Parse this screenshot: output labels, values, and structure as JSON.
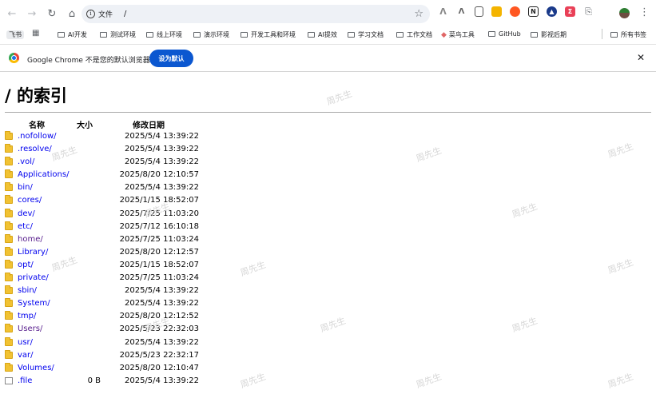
{
  "browser": {
    "site_label": "文件",
    "url": "/",
    "bookmarks": [
      {
        "label": "飞书",
        "type": "chip"
      },
      {
        "label": "AI开发",
        "type": "folder"
      },
      {
        "label": "测试环境",
        "type": "folder"
      },
      {
        "label": "线上环境",
        "type": "folder"
      },
      {
        "label": "演示环境",
        "type": "folder"
      },
      {
        "label": "开发工具和环境",
        "type": "folder"
      },
      {
        "label": "AI提效",
        "type": "folder"
      },
      {
        "label": "学习文档",
        "type": "folder"
      },
      {
        "label": "工作文档",
        "type": "folder"
      },
      {
        "label": "菜鸟工具",
        "type": "site"
      },
      {
        "label": "GitHub",
        "type": "folder"
      },
      {
        "label": "影视后期",
        "type": "folder"
      },
      {
        "label": "所有书签",
        "type": "folder"
      }
    ]
  },
  "infobar": {
    "message": "Google Chrome 不是您的默认浏览器",
    "button_label": "设为默认"
  },
  "page": {
    "title": "/ 的索引",
    "columns": {
      "name": "名称",
      "size": "大小",
      "date": "修改日期"
    },
    "entries": [
      {
        "name": ".nofollow/",
        "size": "",
        "date": "2025/5/4 13:39:22",
        "kind": "folder",
        "visited": false
      },
      {
        "name": ".resolve/",
        "size": "",
        "date": "2025/5/4 13:39:22",
        "kind": "folder",
        "visited": false
      },
      {
        "name": ".vol/",
        "size": "",
        "date": "2025/5/4 13:39:22",
        "kind": "folder",
        "visited": false
      },
      {
        "name": "Applications/",
        "size": "",
        "date": "2025/8/20 12:10:57",
        "kind": "folder",
        "visited": false
      },
      {
        "name": "bin/",
        "size": "",
        "date": "2025/5/4 13:39:22",
        "kind": "folder",
        "visited": false
      },
      {
        "name": "cores/",
        "size": "",
        "date": "2025/1/15 18:52:07",
        "kind": "folder",
        "visited": false
      },
      {
        "name": "dev/",
        "size": "",
        "date": "2025/7/25 11:03:20",
        "kind": "folder",
        "visited": false
      },
      {
        "name": "etc/",
        "size": "",
        "date": "2025/7/12 16:10:18",
        "kind": "folder",
        "visited": false
      },
      {
        "name": "home/",
        "size": "",
        "date": "2025/7/25 11:03:24",
        "kind": "folder",
        "visited": true
      },
      {
        "name": "Library/",
        "size": "",
        "date": "2025/8/20 12:12:57",
        "kind": "folder",
        "visited": false
      },
      {
        "name": "opt/",
        "size": "",
        "date": "2025/1/15 18:52:07",
        "kind": "folder",
        "visited": false
      },
      {
        "name": "private/",
        "size": "",
        "date": "2025/7/25 11:03:24",
        "kind": "folder",
        "visited": false
      },
      {
        "name": "sbin/",
        "size": "",
        "date": "2025/5/4 13:39:22",
        "kind": "folder",
        "visited": false
      },
      {
        "name": "System/",
        "size": "",
        "date": "2025/5/4 13:39:22",
        "kind": "folder",
        "visited": false
      },
      {
        "name": "tmp/",
        "size": "",
        "date": "2025/8/20 12:12:52",
        "kind": "folder",
        "visited": false
      },
      {
        "name": "Users/",
        "size": "",
        "date": "2025/5/23 22:32:03",
        "kind": "folder",
        "visited": true
      },
      {
        "name": "usr/",
        "size": "",
        "date": "2025/5/4 13:39:22",
        "kind": "folder",
        "visited": false
      },
      {
        "name": "var/",
        "size": "",
        "date": "2025/5/23 22:32:17",
        "kind": "folder",
        "visited": false
      },
      {
        "name": "Volumes/",
        "size": "",
        "date": "2025/8/20 12:10:47",
        "kind": "folder",
        "visited": false
      },
      {
        "name": ".file",
        "size": "0 B",
        "date": "2025/5/4 13:39:22",
        "kind": "file",
        "visited": false
      }
    ]
  },
  "watermark_text": "周先生"
}
